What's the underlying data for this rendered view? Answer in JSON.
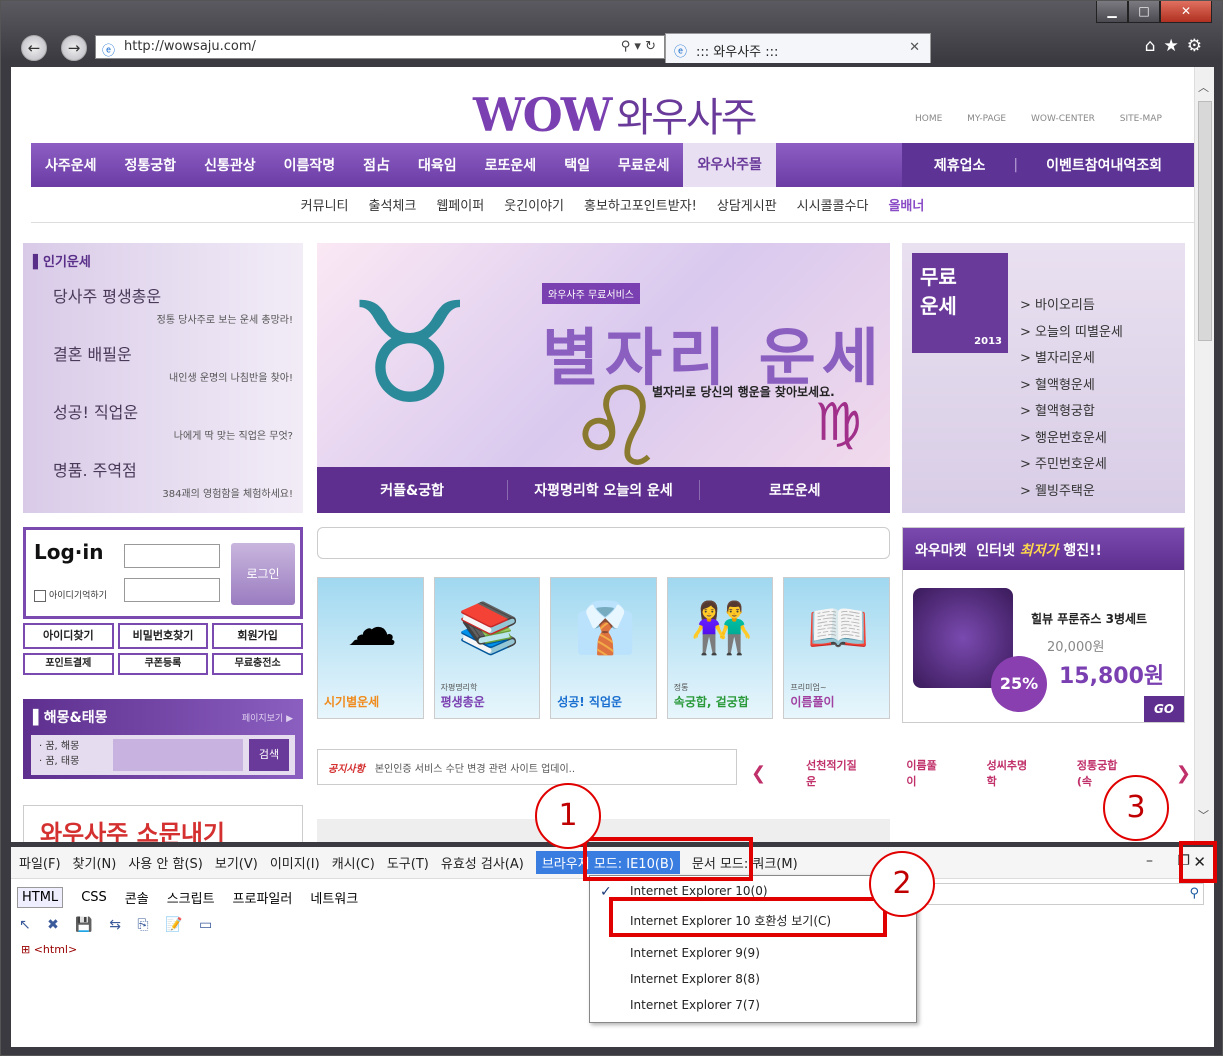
{
  "window": {
    "minimize": "▁",
    "maximize": "□",
    "close": "✕"
  },
  "browser": {
    "back": "←",
    "forward": "→",
    "url": "http://wowsaju.com/",
    "addr_tools": "⚲ ▾ ↻",
    "tab_title": "::: 와우사주 :::",
    "tab_close": "✕",
    "right_tools": "⌂★⚙"
  },
  "site": {
    "logo": "WOW",
    "logo_kr": "와우사주",
    "top_links": "HOME MY-PAGE WOW-CENTER SITE-MAP",
    "main_nav": [
      "사주운세",
      "정통궁합",
      "신통관상",
      "이름작명",
      "점占",
      "대육임",
      "로또운세",
      "택일",
      "무료운세",
      "와우사주몰"
    ],
    "side_nav": [
      "제휴업소",
      "|",
      "이벤트참여내역조회"
    ],
    "sub_nav": [
      "커뮤니티",
      "출석체크",
      "웹페이퍼",
      "웃긴이야기",
      "홍보하고포인트받자!",
      "상담게시판",
      "시시콜콜수다",
      "올배너"
    ],
    "popular": {
      "title": "▌인기운세",
      "items": [
        {
          "title": "당사주 평생총운",
          "desc": "정통 당사주로 보는 운세 총망라!"
        },
        {
          "title": "결혼 배필운",
          "desc": "내인생 운명의 나침반을 찾아!"
        },
        {
          "title": "성공! 직업운",
          "desc": "나에게 딱 맞는 직업은 무엇?"
        },
        {
          "title": "명품. 주역점",
          "desc": "384괘의 영험함을 체험하세요!"
        }
      ]
    },
    "banner": {
      "tag": "와우사주 무료서비스",
      "title": "별자리 운세",
      "subtitle": "별자리로 당신의 행운을 찾아보세요.",
      "sym1": "♉",
      "sym2": "♌",
      "sym3": "♍",
      "tabs": [
        "커플&궁합",
        "자평명리학 오늘의 운세",
        "로또운세"
      ]
    },
    "free": {
      "badge": "무료\n운세",
      "year": "2013",
      "items": [
        "> 바이오리듬",
        "> 오늘의 띠별운세",
        "> 별자리운세",
        "> 혈액형운세",
        "> 혈액형궁합",
        "> 행운번호운세",
        "> 주민번호운세",
        "> 웰빙주택운"
      ]
    },
    "login": {
      "title": "Log·in",
      "remember": "아이디기억하기",
      "button": "로그인",
      "links": [
        "아이디찾기",
        "비밀번호찾기",
        "회원가입",
        "포인트결제",
        "쿠폰등록",
        "무료충전소"
      ]
    },
    "dream": {
      "title": "▌해몽&태몽",
      "more": "페이지보기 ▶",
      "opt1": "· 꿈, 해몽",
      "opt2": "· 꿈, 태몽",
      "go": "검색"
    },
    "promo": "와우사주 소문내기",
    "cards": [
      {
        "small": "",
        "label": "시기별운세",
        "icon": "☁",
        "color": "#f08a1a"
      },
      {
        "small": "자평명리학",
        "label": "평생총운",
        "icon": "📚",
        "color": "#7a3fb0"
      },
      {
        "small": "",
        "label": "성공! 직업운",
        "icon": "👔",
        "color": "#1a6fd0"
      },
      {
        "small": "정통",
        "label": "속궁합, 겉궁합",
        "icon": "👫",
        "color": "#2a9a3a"
      },
      {
        "small": "프리미엄~",
        "label": "이름풀이",
        "icon": "📖",
        "color": "#a040a0"
      }
    ],
    "notice": {
      "label": "공지사항",
      "text": "본인인증 서비스 수단 변경 관련 사이트 업데이.."
    },
    "tickers": {
      "prev": "❮",
      "next": "❯",
      "items": [
        "선천적기질운",
        "이름풀이",
        "성씨추명학",
        "정통궁합 (속"
      ]
    },
    "market": {
      "head1": "와우마켓",
      "head2": "인터넷",
      "head3": "최저가",
      "head4": "행진!!",
      "name": "힐뷰 푸룬쥬스 3병세트",
      "old_price": "20,000원",
      "new_price": "15,800원",
      "discount": "25%",
      "go": "GO"
    }
  },
  "devtools": {
    "menu": [
      "파일(F)",
      "찾기(N)",
      "사용 안 함(S)",
      "보기(V)",
      "이미지(I)",
      "캐시(C)",
      "도구(T)",
      "유효성 검사(A)"
    ],
    "browser_mode": "브라우저 모드: IE10(B)",
    "doc_mode": "문서 모드: 쿼크(M)",
    "controls": "– ❐",
    "close": "✕",
    "tabs": [
      "HTML",
      "CSS",
      "콘솔",
      "스크립트",
      "프로파일러",
      "네트워크"
    ],
    "toolbar": "↖ ✖ 💾 ⇆ ⎘ 📝 ▭",
    "tree": "⊞ <html>",
    "search_icon": "⚲",
    "dropdown": {
      "check": "✓",
      "items": [
        "Internet Explorer 10(0)",
        "Internet Explorer 10 호환성 보기(C)",
        "Internet Explorer 9(9)",
        "Internet Explorer 8(8)",
        "Internet Explorer 7(7)"
      ]
    }
  },
  "annotations": [
    "1",
    "2",
    "3"
  ]
}
